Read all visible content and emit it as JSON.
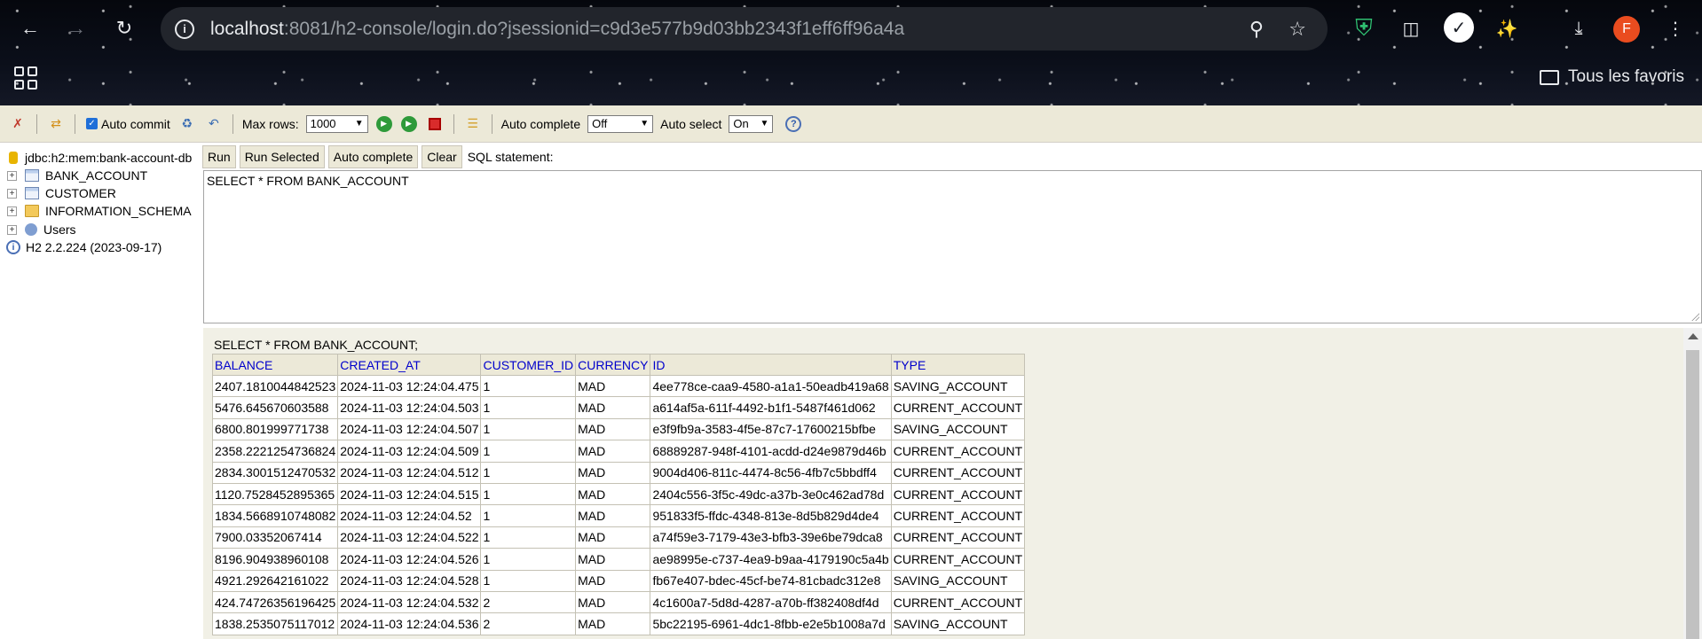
{
  "browser": {
    "url_host": "localhost",
    "url_rest": ":8081/h2-console/login.do?jsessionid=c9d3e577b9d03bb2343f1eff6ff96a4a",
    "bookmarks_label": "Tous les favoris",
    "avatar_letter": "F",
    "icons": [
      "back-icon",
      "forward-icon",
      "reload-icon",
      "site-info-icon",
      "zoom-icon",
      "star-icon",
      "shield-extension-icon",
      "camera-icon",
      "check-extension-icon",
      "puzzle-icon",
      "download-icon",
      "kebab-menu-icon",
      "apps-grid-icon",
      "folder-icon"
    ]
  },
  "toolbar": {
    "auto_commit_label": "Auto commit",
    "max_rows_label": "Max rows:",
    "max_rows_value": "1000",
    "auto_complete_label": "Auto complete",
    "auto_complete_value": "Off",
    "auto_select_label": "Auto select",
    "auto_select_value": "On",
    "help_glyph": "?"
  },
  "tree": {
    "connection": "jdbc:h2:mem:bank-account-db",
    "items": [
      {
        "label": "BANK_ACCOUNT",
        "icon": "table-icon"
      },
      {
        "label": "CUSTOMER",
        "icon": "table-icon"
      },
      {
        "label": "INFORMATION_SCHEMA",
        "icon": "folder-icon"
      },
      {
        "label": "Users",
        "icon": "users-icon"
      }
    ],
    "version": "H2 2.2.224 (2023-09-17)"
  },
  "query": {
    "run_label": "Run",
    "run_selected_label": "Run Selected",
    "auto_complete_label": "Auto complete",
    "clear_label": "Clear",
    "sql_statement_label": "SQL statement:",
    "sql_text": "SELECT * FROM BANK_ACCOUNT"
  },
  "results": {
    "query_echo": "SELECT * FROM BANK_ACCOUNT;",
    "columns": [
      "BALANCE",
      "CREATED_AT",
      "CUSTOMER_ID",
      "CURRENCY",
      "ID",
      "TYPE"
    ],
    "rows": [
      [
        "2407.1810044842523",
        "2024-11-03 12:24:04.475",
        "1",
        "MAD",
        "4ee778ce-caa9-4580-a1a1-50eadb419a68",
        "SAVING_ACCOUNT"
      ],
      [
        "5476.645670603588",
        "2024-11-03 12:24:04.503",
        "1",
        "MAD",
        "a614af5a-611f-4492-b1f1-5487f461d062",
        "CURRENT_ACCOUNT"
      ],
      [
        "6800.801999771738",
        "2024-11-03 12:24:04.507",
        "1",
        "MAD",
        "e3f9fb9a-3583-4f5e-87c7-17600215bfbe",
        "SAVING_ACCOUNT"
      ],
      [
        "2358.2221254736824",
        "2024-11-03 12:24:04.509",
        "1",
        "MAD",
        "68889287-948f-4101-acdd-d24e9879d46b",
        "CURRENT_ACCOUNT"
      ],
      [
        "2834.3001512470532",
        "2024-11-03 12:24:04.512",
        "1",
        "MAD",
        "9004d406-811c-4474-8c56-4fb7c5bbdff4",
        "CURRENT_ACCOUNT"
      ],
      [
        "1120.7528452895365",
        "2024-11-03 12:24:04.515",
        "1",
        "MAD",
        "2404c556-3f5c-49dc-a37b-3e0c462ad78d",
        "CURRENT_ACCOUNT"
      ],
      [
        "1834.5668910748082",
        "2024-11-03 12:24:04.52",
        "1",
        "MAD",
        "951833f5-ffdc-4348-813e-8d5b829d4de4",
        "CURRENT_ACCOUNT"
      ],
      [
        "7900.03352067414",
        "2024-11-03 12:24:04.522",
        "1",
        "MAD",
        "a74f59e3-7179-43e3-bfb3-39e6be79dca8",
        "CURRENT_ACCOUNT"
      ],
      [
        "8196.904938960108",
        "2024-11-03 12:24:04.526",
        "1",
        "MAD",
        "ae98995e-c737-4ea9-b9aa-4179190c5a4b",
        "CURRENT_ACCOUNT"
      ],
      [
        "4921.292642161022",
        "2024-11-03 12:24:04.528",
        "1",
        "MAD",
        "fb67e407-bdec-45cf-be74-81cbadc312e8",
        "SAVING_ACCOUNT"
      ],
      [
        "424.74726356196425",
        "2024-11-03 12:24:04.532",
        "2",
        "MAD",
        "4c1600a7-5d8d-4287-a70b-ff382408df4d",
        "CURRENT_ACCOUNT"
      ],
      [
        "1838.2535075117012",
        "2024-11-03 12:24:04.536",
        "2",
        "MAD",
        "5bc22195-6961-4dc1-8fbb-e2e5b1008a7d",
        "SAVING_ACCOUNT"
      ]
    ]
  }
}
